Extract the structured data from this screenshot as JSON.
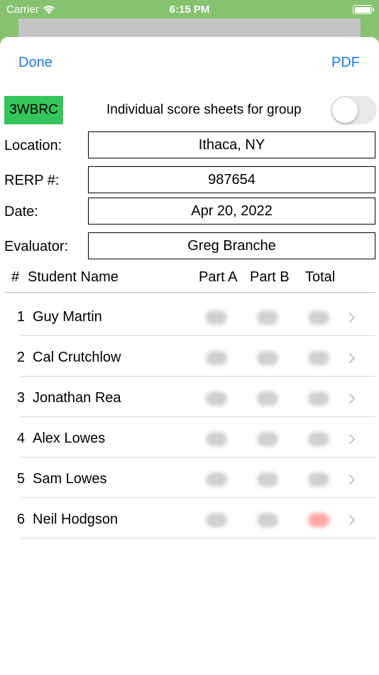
{
  "status_bar": {
    "carrier": "Carrier",
    "time": "6:15 PM"
  },
  "nav": {
    "done_label": "Done",
    "pdf_label": "PDF"
  },
  "group": {
    "code": "3WBRC",
    "individual_sheets_label": "Individual score sheets for group",
    "individual_sheets_on": false
  },
  "fields": {
    "location_label": "Location:",
    "location_value": "Ithaca, NY",
    "rerp_label": "RERP #:",
    "rerp_value": "987654",
    "date_label": "Date:",
    "date_value": "Apr 20, 2022",
    "evaluator_label": "Evaluator:",
    "evaluator_value": "Greg Branche"
  },
  "table": {
    "headers": {
      "num": "#",
      "name": "Student Name",
      "part_a": "Part A",
      "part_b": "Part B",
      "total": "Total"
    },
    "rows": [
      {
        "num": "1",
        "name": "Guy Martin"
      },
      {
        "num": "2",
        "name": "Cal Crutchlow"
      },
      {
        "num": "3",
        "name": "Jonathan Rea"
      },
      {
        "num": "4",
        "name": "Alex Lowes"
      },
      {
        "num": "5",
        "name": "Sam Lowes"
      },
      {
        "num": "6",
        "name": "Neil Hodgson"
      }
    ]
  },
  "colors": {
    "background": "#86c26f",
    "accent_blue": "#1d7cf2",
    "badge_green": "#35c55a",
    "alert_red": "#ff3c3c"
  }
}
